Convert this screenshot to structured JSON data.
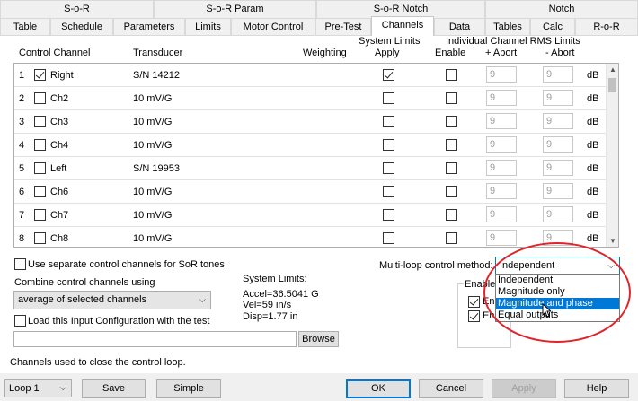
{
  "tabs_row1": [
    "S-o-R",
    "S-o-R Param",
    "S-o-R Notch",
    "Notch"
  ],
  "tabs_row2": [
    "Table",
    "Schedule",
    "Parameters",
    "Limits",
    "Motor Control",
    "Pre-Test",
    "Channels",
    "Data",
    "Tables",
    "Calc",
    "R-o-R"
  ],
  "active_tab": "Channels",
  "headers": {
    "control_channel": "Control Channel",
    "transducer": "Transducer",
    "weighting": "Weighting",
    "system_limits": "System Limits",
    "apply": "Apply",
    "individual": "Individual Channel RMS Limits",
    "enable": "Enable",
    "plus_abort": "+ Abort",
    "minus_abort": "- Abort"
  },
  "rows": [
    {
      "num": "1",
      "checked": true,
      "name": "Right",
      "transducer": "S/N 14212",
      "apply": true,
      "enable": false,
      "plus": "9",
      "minus": "9",
      "unit": "dB"
    },
    {
      "num": "2",
      "checked": false,
      "name": "Ch2",
      "transducer": "10 mV/G",
      "apply": false,
      "enable": false,
      "plus": "9",
      "minus": "9",
      "unit": "dB"
    },
    {
      "num": "3",
      "checked": false,
      "name": "Ch3",
      "transducer": "10 mV/G",
      "apply": false,
      "enable": false,
      "plus": "9",
      "minus": "9",
      "unit": "dB"
    },
    {
      "num": "4",
      "checked": false,
      "name": "Ch4",
      "transducer": "10 mV/G",
      "apply": false,
      "enable": false,
      "plus": "9",
      "minus": "9",
      "unit": "dB"
    },
    {
      "num": "5",
      "checked": false,
      "name": "Left",
      "transducer": "S/N 19953",
      "apply": false,
      "enable": false,
      "plus": "9",
      "minus": "9",
      "unit": "dB"
    },
    {
      "num": "6",
      "checked": false,
      "name": "Ch6",
      "transducer": "10 mV/G",
      "apply": false,
      "enable": false,
      "plus": "9",
      "minus": "9",
      "unit": "dB"
    },
    {
      "num": "7",
      "checked": false,
      "name": "Ch7",
      "transducer": "10 mV/G",
      "apply": false,
      "enable": false,
      "plus": "9",
      "minus": "9",
      "unit": "dB"
    },
    {
      "num": "8",
      "checked": false,
      "name": "Ch8",
      "transducer": "10 mV/G",
      "apply": false,
      "enable": false,
      "plus": "9",
      "minus": "9",
      "unit": "dB"
    }
  ],
  "separate_label": "Use separate control channels for SoR tones",
  "combine_label": "Combine control channels using",
  "combine_value": "average of selected channels",
  "load_label": "Load this Input Configuration with the test",
  "browse_label": "Browse",
  "system_limits": {
    "title": "System Limits:",
    "accel": "Accel=36.5041 G",
    "vel": "Vel=59 in/s",
    "disp": "Disp=1.77 in"
  },
  "multiloop_label": "Multi-loop control method:",
  "multiloop_value": "Independent",
  "multiloop_options": [
    "Independent",
    "Magnitude only",
    "Magnitude and phase",
    "Equal outputs"
  ],
  "highlighted_option": "Magnitude and phase",
  "enable_group_label": "Enable",
  "enable_partial_1": "En",
  "enable_partial_2": "En",
  "footer_text": "Channels used to close the control loop.",
  "bottom": {
    "loop_value": "Loop 1",
    "save": "Save",
    "simple": "Simple",
    "ok": "OK",
    "cancel": "Cancel",
    "apply": "Apply",
    "help": "Help"
  }
}
